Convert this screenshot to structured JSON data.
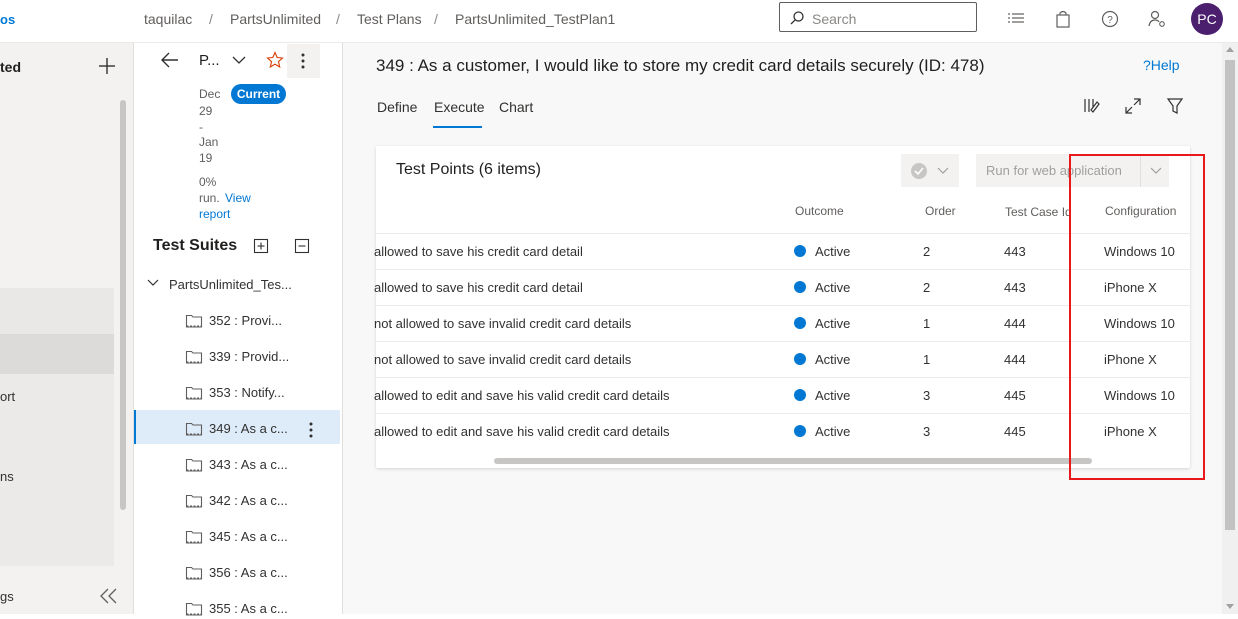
{
  "topbar": {
    "brand_fragment": "os",
    "breadcrumb": [
      "taquilac",
      "PartsUnlimited",
      "Test Plans",
      "PartsUnlimited_TestPlan1"
    ],
    "separator": "/",
    "search_placeholder": "Search",
    "avatar_initials": "PC"
  },
  "leftnav": {
    "title_fragment": "ted",
    "items": [
      "ort",
      "ns",
      "gs"
    ]
  },
  "plan_panel": {
    "plan_name": "P...",
    "status_badge": "Current",
    "date_lines": [
      "Dec",
      "29",
      "-",
      "Jan",
      "19"
    ],
    "run_text": "0%",
    "run_text2": "run.",
    "view_report_link": "View",
    "view_report_link2": "report",
    "suites_title": "Test Suites",
    "root_suite": "PartsUnlimited_Tes...",
    "suites": [
      {
        "label": "352 : Provi..."
      },
      {
        "label": "339 : Provid..."
      },
      {
        "label": "353 : Notify..."
      },
      {
        "label": "349 : As a c..."
      },
      {
        "label": "343 : As a c..."
      },
      {
        "label": "342 : As a c..."
      },
      {
        "label": "345 : As a c..."
      },
      {
        "label": "356 : As a c..."
      },
      {
        "label": "355 : As a c..."
      }
    ]
  },
  "main": {
    "title": "349 : As a customer, I would like to store my credit card details securely (ID: 478)",
    "help": "?Help",
    "tabs": [
      "Define",
      "Execute",
      "Chart"
    ],
    "active_tab": "Execute",
    "card_title": "Test Points (6 items)",
    "run_button": "Run for web application",
    "columns": [
      "Outcome",
      "Order",
      "Test Case Id",
      "Configuration"
    ],
    "rows": [
      {
        "title": "allowed to save his credit card detail",
        "outcome": "Active",
        "order": "2",
        "test_case_id": "443",
        "configuration": "Windows 10"
      },
      {
        "title": "allowed to save his credit card detail",
        "outcome": "Active",
        "order": "2",
        "test_case_id": "443",
        "configuration": "iPhone X"
      },
      {
        "title": "not allowed to save invalid credit card details",
        "outcome": "Active",
        "order": "1",
        "test_case_id": "444",
        "configuration": "Windows 10"
      },
      {
        "title": "not allowed to save invalid credit card details",
        "outcome": "Active",
        "order": "1",
        "test_case_id": "444",
        "configuration": "iPhone X"
      },
      {
        "title": "allowed to edit and save his valid credit card details",
        "outcome": "Active",
        "order": "3",
        "test_case_id": "445",
        "configuration": "Windows 10"
      },
      {
        "title": "allowed to edit and save his valid credit card details",
        "outcome": "Active",
        "order": "3",
        "test_case_id": "445",
        "configuration": "iPhone X"
      }
    ]
  },
  "colors": {
    "accent": "#0078d4",
    "highlight": "#e8181b",
    "avatar_bg": "#4b1e6e",
    "star": "#d83b01"
  }
}
